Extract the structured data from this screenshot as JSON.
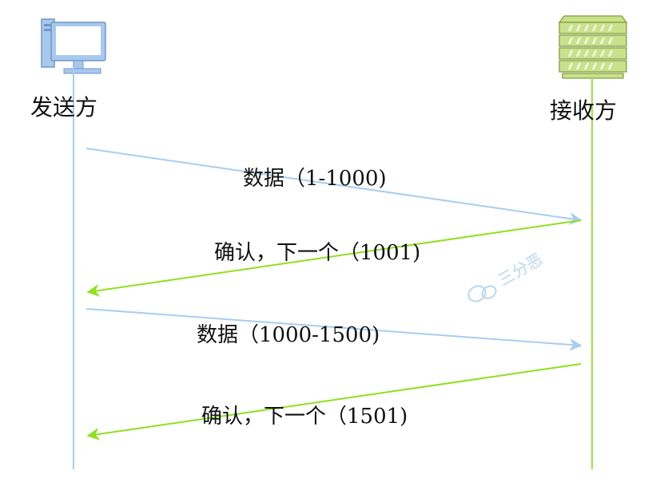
{
  "sender": {
    "label": "发送方",
    "icon": "computer-icon",
    "color": "#a7cdf0"
  },
  "receiver": {
    "label": "接收方",
    "icon": "server-icon",
    "color": "#9be33f"
  },
  "messages": [
    {
      "label": "数据（1-1000)",
      "from": "sender",
      "to": "receiver"
    },
    {
      "label": "确认，下一个（1001)",
      "from": "receiver",
      "to": "sender"
    },
    {
      "label": "数据（1000-1500)",
      "from": "sender",
      "to": "receiver"
    },
    {
      "label": "确认，下一个（1501)",
      "from": "receiver",
      "to": "sender"
    }
  ],
  "watermark": {
    "text": "三分恶",
    "icon": "wechat-icon"
  }
}
